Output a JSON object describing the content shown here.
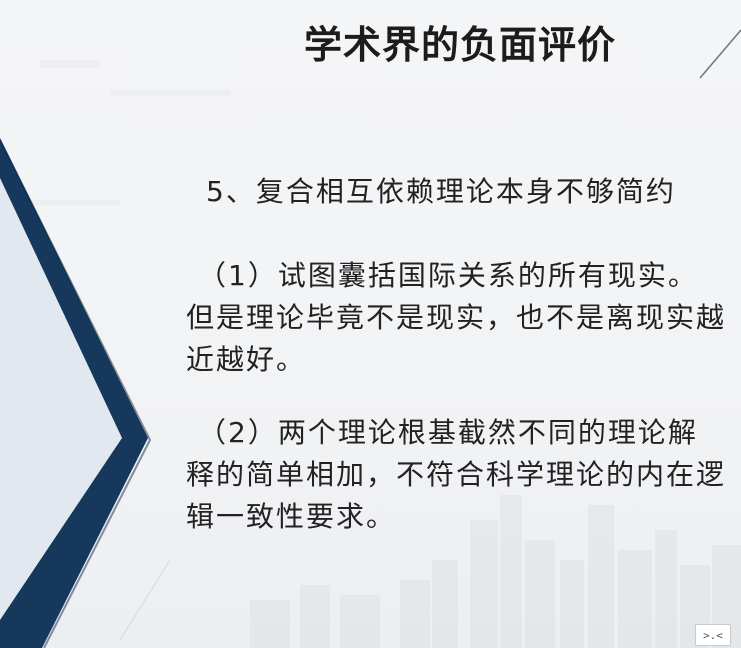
{
  "slide": {
    "title": "学术界的负面评价",
    "heading": "5、复合相互依赖理论本身不够简约",
    "points": [
      "（1）试图囊括国际关系的所有现实。但是理论毕竟不是现实，也不是离现实越近越好。",
      "（2）两个理论根基截然不同的理论解释的简单相加，不符合科学理论的内在逻辑一致性要求。"
    ]
  },
  "colors": {
    "chevron": "#16385c",
    "chevron_light": "#dde6ef",
    "background": "#f3f4f6"
  },
  "corner_widget": {
    "icon": "expand-icon",
    "label": ">.<"
  }
}
